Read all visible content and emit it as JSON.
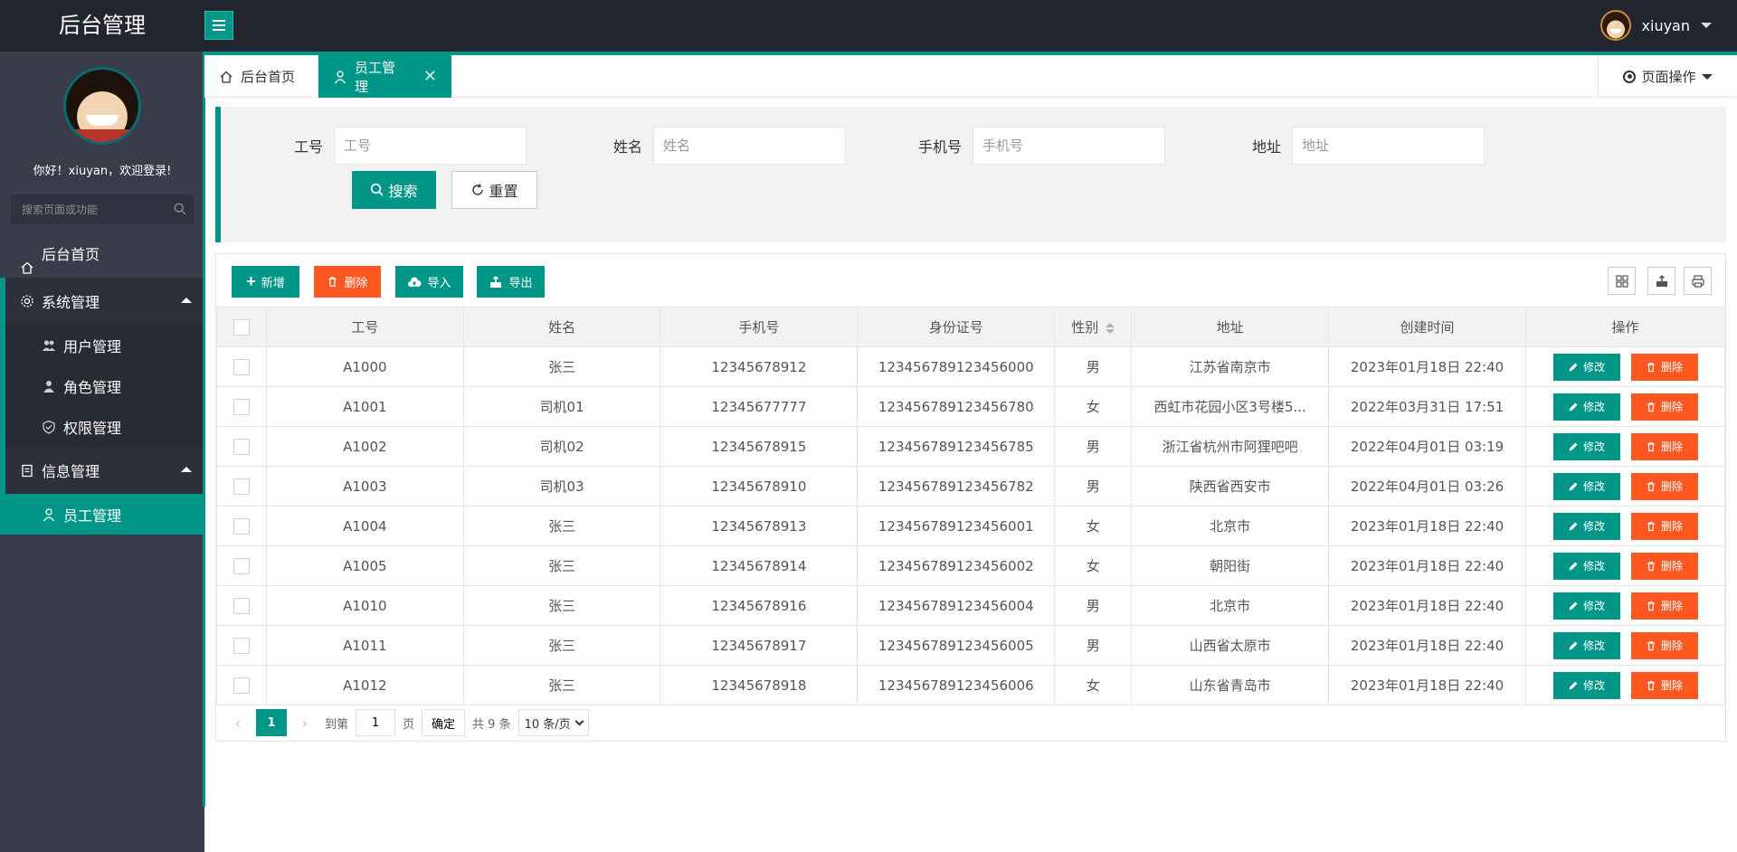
{
  "header": {
    "logo": "后台管理",
    "username": "xiuyan"
  },
  "sidebar": {
    "welcome": "你好！xiuyan，欢迎登录!",
    "search_placeholder": "搜索页面或功能",
    "home": "后台首页",
    "groups": [
      {
        "label": "系统管理",
        "items": [
          "用户管理",
          "角色管理",
          "权限管理"
        ]
      },
      {
        "label": "信息管理",
        "items": [
          "员工管理"
        ]
      }
    ]
  },
  "tabs": {
    "home": "后台首页",
    "active": "员工管理",
    "close": "✕",
    "page_op": "页面操作"
  },
  "search": {
    "fields": [
      {
        "label": "工号",
        "placeholder": "工号"
      },
      {
        "label": "姓名",
        "placeholder": "姓名"
      },
      {
        "label": "手机号",
        "placeholder": "手机号"
      },
      {
        "label": "地址",
        "placeholder": "地址"
      }
    ],
    "search_btn": "搜索",
    "reset_btn": "重置"
  },
  "toolbar": {
    "add": "新增",
    "delete": "删除",
    "import": "导入",
    "export": "导出"
  },
  "table": {
    "columns": [
      "工号",
      "姓名",
      "手机号",
      "身份证号",
      "性别",
      "地址",
      "创建时间",
      "操作"
    ],
    "edit_label": "修改",
    "delete_label": "删除",
    "rows": [
      [
        "A1000",
        "张三",
        "12345678912",
        "123456789123456000",
        "男",
        "江苏省南京市",
        "2023年01月18日 22:40"
      ],
      [
        "A1001",
        "司机01",
        "12345677777",
        "123456789123456780",
        "女",
        "西虹市花园小区3号楼5...",
        "2022年03月31日 17:51"
      ],
      [
        "A1002",
        "司机02",
        "12345678915",
        "123456789123456785",
        "男",
        "浙江省杭州市阿狸吧吧",
        "2022年04月01日 03:19"
      ],
      [
        "A1003",
        "司机03",
        "12345678910",
        "123456789123456782",
        "男",
        "陕西省西安市",
        "2022年04月01日 03:26"
      ],
      [
        "A1004",
        "张三",
        "12345678913",
        "123456789123456001",
        "女",
        "北京市",
        "2023年01月18日 22:40"
      ],
      [
        "A1005",
        "张三",
        "12345678914",
        "123456789123456002",
        "女",
        "朝阳街",
        "2023年01月18日 22:40"
      ],
      [
        "A1010",
        "张三",
        "12345678916",
        "123456789123456004",
        "男",
        "北京市",
        "2023年01月18日 22:40"
      ],
      [
        "A1011",
        "张三",
        "12345678917",
        "123456789123456005",
        "男",
        "山西省太原市",
        "2023年01月18日 22:40"
      ],
      [
        "A1012",
        "张三",
        "12345678918",
        "123456789123456006",
        "女",
        "山东省青岛市",
        "2023年01月18日 22:40"
      ]
    ]
  },
  "pager": {
    "prev": "‹",
    "next": "›",
    "current": "1",
    "goto_label": "到第",
    "goto_value": "1",
    "page_unit": "页",
    "confirm": "确定",
    "total": "共 9 条",
    "page_size": "10 条/页"
  },
  "colors": {
    "accent": "#009688",
    "danger": "#ff5722",
    "sidebar": "#393d49",
    "topbar": "#23262e"
  }
}
